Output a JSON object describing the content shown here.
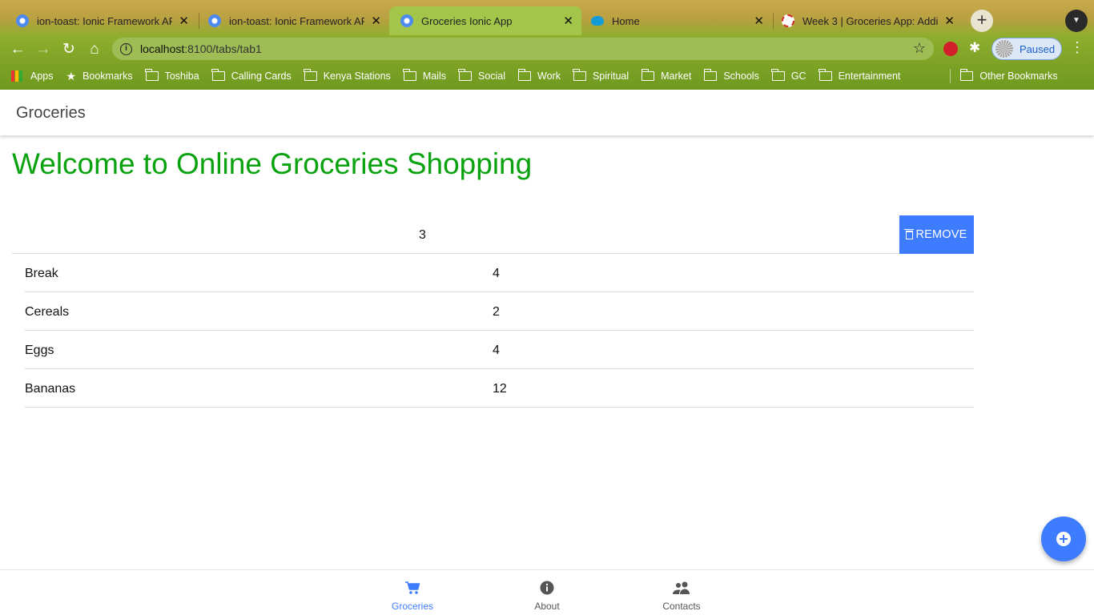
{
  "browser": {
    "tabs": [
      {
        "title": "ion-toast: Ionic Framework API",
        "close": "✕"
      },
      {
        "title": "ion-toast: Ionic Framework API",
        "close": "✕"
      },
      {
        "title": "Groceries Ionic App",
        "close": "✕"
      },
      {
        "title": "Home",
        "close": "✕"
      },
      {
        "title": "Week 3 | Groceries App: Adding",
        "close": "✕"
      }
    ],
    "new_tab": "+",
    "address": {
      "host": "localhost",
      "path": ":8100/tabs/tab1"
    },
    "profile_status": "Paused",
    "bookmarks": [
      "Apps",
      "Bookmarks",
      "Toshiba",
      "Calling Cards",
      "Kenya Stations",
      "Mails",
      "Social",
      "Work",
      "Spiritual",
      "Market",
      "Schools",
      "GC",
      "Entertainment"
    ],
    "other_bookmarks": "Other Bookmarks"
  },
  "header": {
    "title": "Groceries"
  },
  "main": {
    "welcome": "Welcome to Online Groceries Shopping",
    "count": "3",
    "remove_label": "REMOVE",
    "items": [
      {
        "name": "Break",
        "qty": "4"
      },
      {
        "name": "Cereals",
        "qty": "2"
      },
      {
        "name": "Eggs",
        "qty": "4"
      },
      {
        "name": "Bananas",
        "qty": "12"
      }
    ]
  },
  "tabbar": {
    "tabs": [
      {
        "label": "Groceries",
        "icon": "cart-icon"
      },
      {
        "label": "About",
        "icon": "info-icon"
      },
      {
        "label": "Contacts",
        "icon": "people-icon"
      }
    ]
  },
  "colors": {
    "accent": "#3d7bff",
    "welcome": "#0aa30f"
  }
}
